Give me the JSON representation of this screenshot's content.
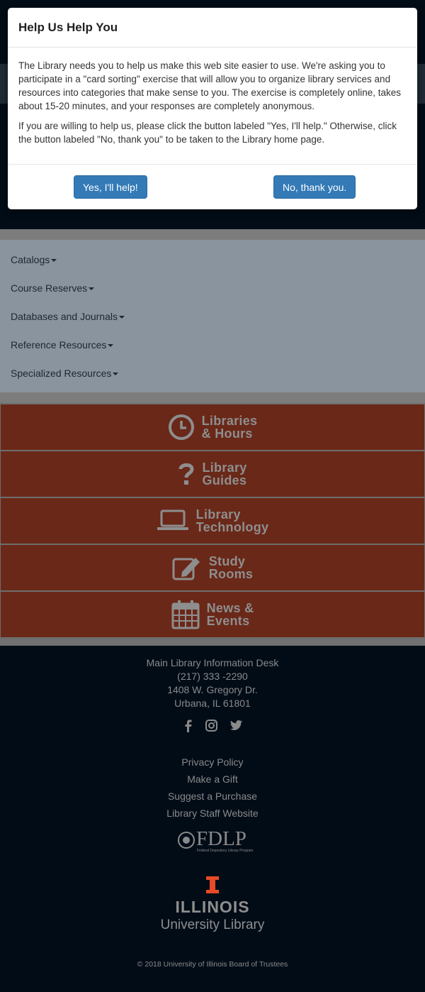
{
  "modal": {
    "title": "Help Us Help You",
    "paragraph1": "The Library needs you to help us make this web site easier to use. We're asking you to participate in a \"card sorting\" exercise that will allow you to organize library services and resources into categories that make sense to you. The exercise is completely online, takes about 15-20 minutes, and your responses are completely anonymous.",
    "paragraph2": "If you are willing to help us, please click the button labeled \"Yes, I'll help.\" Otherwise, click the button labeled \"No, thank you\" to be taken to the Library home page.",
    "yes_button": "Yes, I'll help!",
    "no_button": "No, thank you."
  },
  "nav": {
    "items": [
      {
        "label": "Catalogs"
      },
      {
        "label": "Course Reserves"
      },
      {
        "label": "Databases and Journals"
      },
      {
        "label": "Reference Resources"
      },
      {
        "label": "Specialized Resources"
      }
    ]
  },
  "tiles": [
    {
      "line1": "Libraries",
      "line2": "& Hours",
      "icon": "clock-icon"
    },
    {
      "line1": "Library",
      "line2": "Guides",
      "icon": "question-icon"
    },
    {
      "line1": "Library",
      "line2": "Technology",
      "icon": "laptop-icon"
    },
    {
      "line1": "Study",
      "line2": "Rooms",
      "icon": "edit-icon"
    },
    {
      "line1": "News &",
      "line2": "Events",
      "icon": "calendar-icon"
    }
  ],
  "footer": {
    "desk_title": "Main Library Information Desk",
    "phone": "(217) 333 -2290",
    "street": "1408 W. Gregory Dr.",
    "city": "Urbana, IL 61801",
    "social_icons": [
      "facebook-icon",
      "instagram-icon",
      "twitter-icon"
    ],
    "links": [
      "Privacy Policy",
      "Make a Gift",
      "Suggest a Purchase",
      "Library Staff Website"
    ],
    "fdlp_logo": "FDLP",
    "fdlp_subtitle": "Federal Depository Library Program",
    "illinois_wordmark": "ILLINOIS",
    "university_library": "University Library",
    "copyright": "© 2018 University of Illinois Board of Trustees"
  },
  "colors": {
    "navy": "#020c17",
    "tile_orange": "#6a2818",
    "button_blue": "#337ab7",
    "illinois_orange": "#e84a27"
  }
}
